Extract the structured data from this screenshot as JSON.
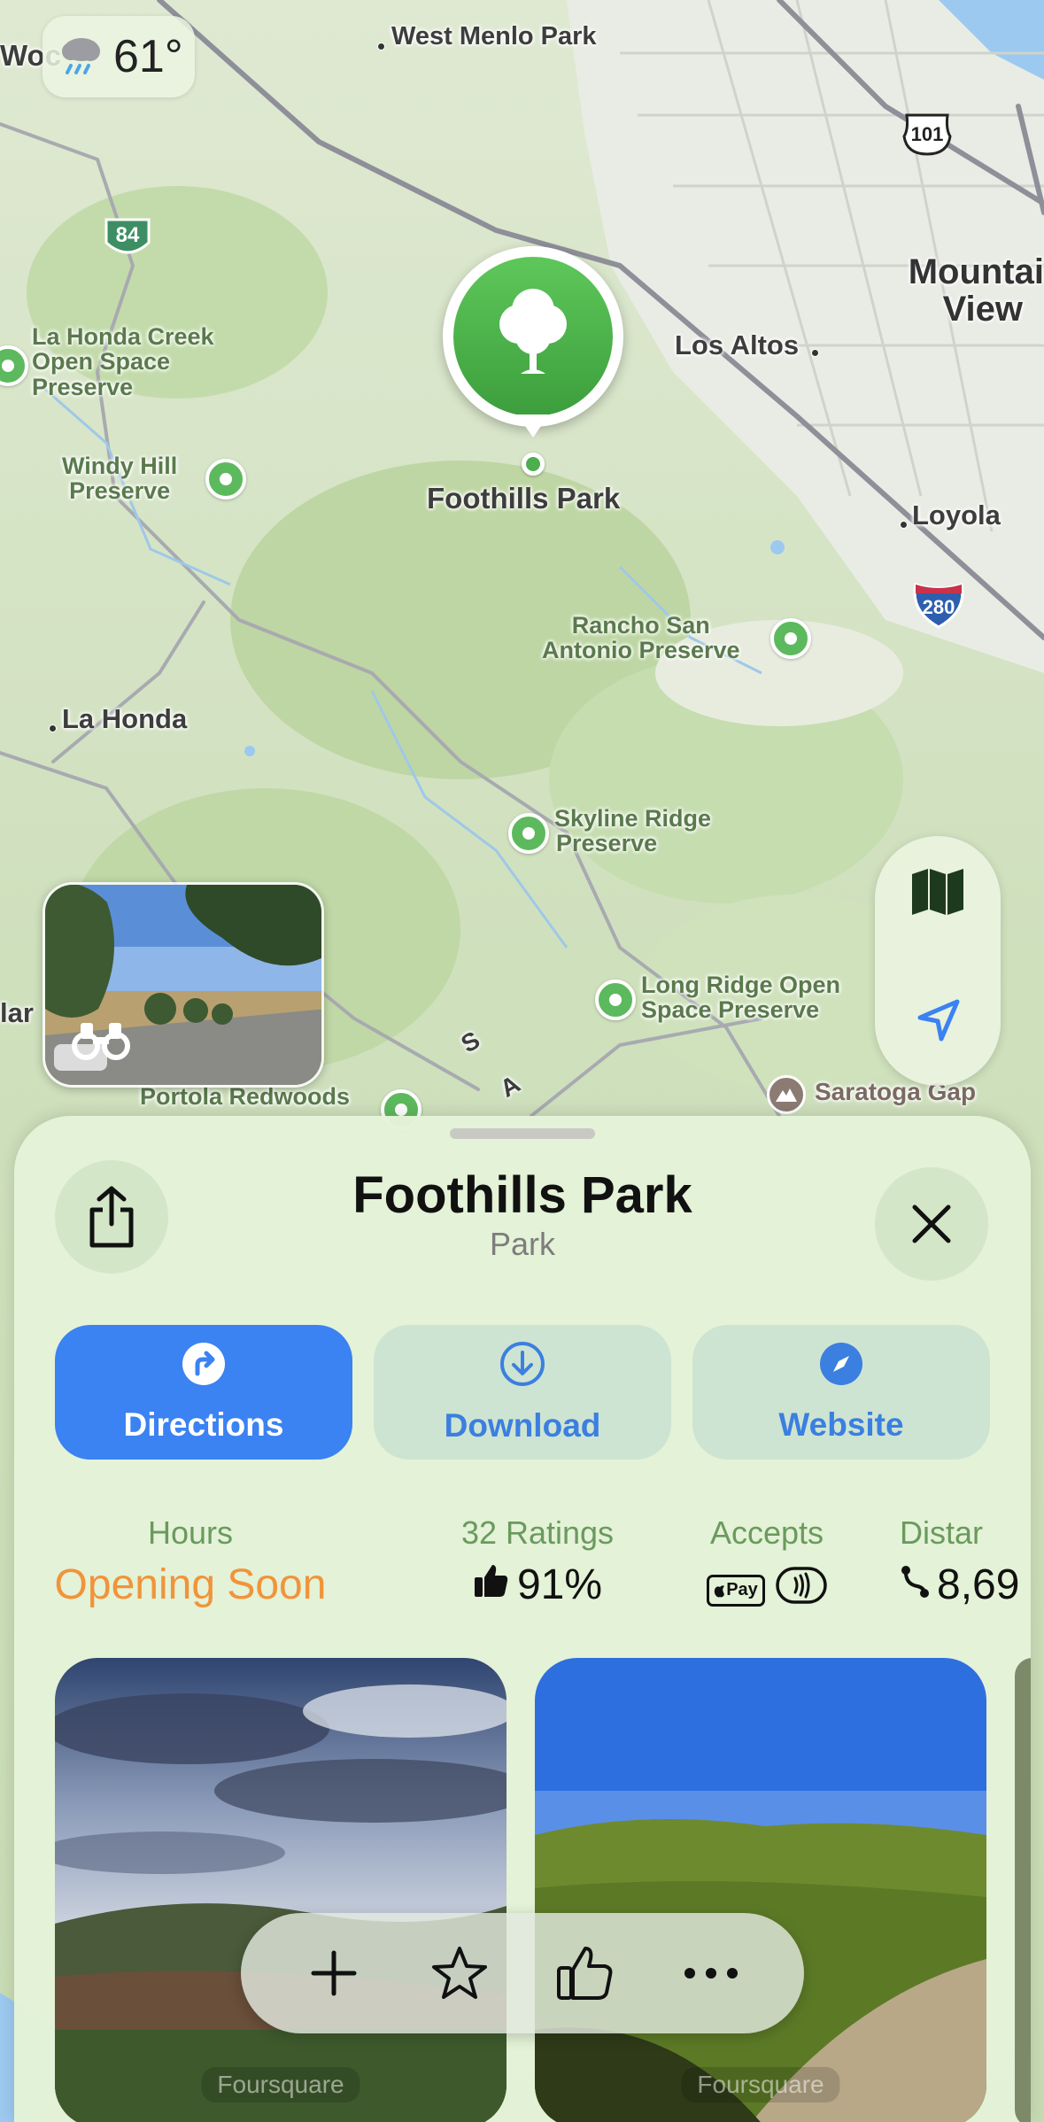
{
  "weather": {
    "temperature": "61°",
    "icon": "cloud-rain-icon"
  },
  "map": {
    "labels": {
      "west_menlo_park": "West Menlo Park",
      "mountain_view": "Mountain View",
      "mountain_view_line1": "Mountai",
      "mountain_view_line2": "View",
      "los_altos": "Los Altos",
      "loyola": "Loyola",
      "la_honda_creek": "La Honda Creek Open Space Preserve",
      "la_honda_creek_l1": "La Honda Creek",
      "la_honda_creek_l2": "Open Space",
      "la_honda_creek_l3": "Preserve",
      "windy_hill_l1": "Windy Hill",
      "windy_hill_l2": "Preserve",
      "foothills_park": "Foothills Park",
      "rancho_l1": "Rancho San",
      "rancho_l2": "Antonio Preserve",
      "la_honda": "La Honda",
      "skyline_l1": "Skyline Ridge",
      "skyline_l2": "Preserve",
      "long_ridge_l1": "Long Ridge Open",
      "long_ridge_l2": "Space Preserve",
      "portola": "Portola Redwoods",
      "saratoga_gap": "Saratoga Gap",
      "woc": "Woc",
      "lar": "lar",
      "road_s": "S",
      "road_a": "A"
    },
    "shields": {
      "hwy84": "84",
      "us101": "101",
      "i280": "280"
    }
  },
  "sheet": {
    "title": "Foothills Park",
    "subtitle": "Park",
    "actions": {
      "directions": "Directions",
      "download": "Download",
      "website": "Website"
    },
    "info": {
      "hours_label": "Hours",
      "hours_value": "Opening Soon",
      "ratings_label": "32 Ratings",
      "ratings_value": "91%",
      "accepts_label": "Accepts",
      "accepts_apple_pay": "Pay",
      "distance_label": "Distar",
      "distance_value": "8,69"
    },
    "photo_credit": "Foursquare"
  },
  "colors": {
    "accent": "#3b82f2",
    "park_green": "#4cae4c",
    "hours_orange": "#f0943a"
  }
}
